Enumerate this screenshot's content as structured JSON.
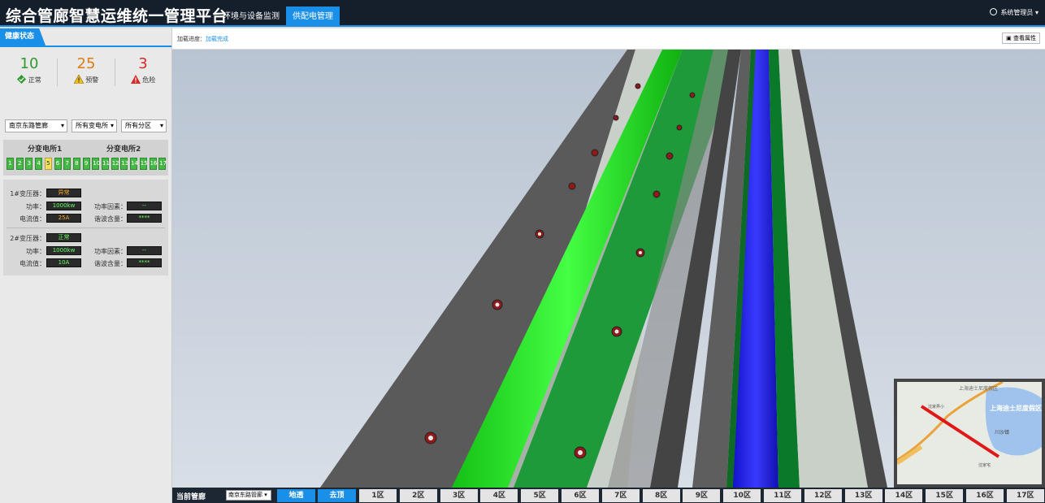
{
  "header": {
    "title": "综合管廊智慧运维统一管理平台",
    "tabs": [
      "环境与设备监测",
      "供配电管理"
    ],
    "active_tab": 1,
    "user": "系统管理员"
  },
  "sidebar": {
    "section_title": "健康状态",
    "counts": [
      {
        "value": "10",
        "label": "正常",
        "color": "#2e9a2e",
        "icon": "diamond-check-icon"
      },
      {
        "value": "25",
        "label": "预警",
        "color": "#e07a10",
        "icon": "warning-icon"
      },
      {
        "value": "3",
        "label": "危险",
        "color": "#d42a2a",
        "icon": "danger-icon"
      }
    ],
    "filters": [
      "南京东路管廊",
      "所有变电所",
      "所有分区"
    ],
    "stations": {
      "labels": [
        "分变电所1",
        "分变电所2"
      ],
      "segments": [
        "1",
        "2",
        "3",
        "4",
        "5",
        "6",
        "7",
        "8",
        "9",
        "10",
        "11",
        "12",
        "13",
        "14",
        "15",
        "16",
        "17"
      ],
      "warning_segment": "5"
    },
    "transformers": [
      {
        "name_label": "1#变压器：",
        "status": "异常",
        "power_label": "功率：",
        "power": "1000kw",
        "factor_label": "功率因素：",
        "factor": "--",
        "current_label": "电流值：",
        "current": "25A",
        "harmonic_label": "谐波含量：",
        "harmonic": "****"
      },
      {
        "name_label": "2#变压器：",
        "status": "正常",
        "power_label": "功率：",
        "power": "1000kw",
        "factor_label": "功率因素：",
        "factor": "--",
        "current_label": "电流值：",
        "current": "10A",
        "harmonic_label": "谐波含量：",
        "harmonic": "****"
      }
    ]
  },
  "main": {
    "load_label": "加载进度：",
    "load_value": "加载完成",
    "attr_button": "查看属性",
    "minimap": {
      "label_top": "上海迪士尼度假区",
      "label_big": "上海迪士尼度假区",
      "label_mid": "沈家弄小",
      "label_right": "川沙镇",
      "label_bottom": "沈家宅"
    }
  },
  "bottombar": {
    "current_label": "当前管廊",
    "current_value": "南京东路管廊",
    "buttons": [
      "地透",
      "去顶"
    ],
    "zones": [
      "1区",
      "2区",
      "3区",
      "4区",
      "5区",
      "6区",
      "7区",
      "8区",
      "9区",
      "10区",
      "11区",
      "12区",
      "13区",
      "14区",
      "15区",
      "16区",
      "17区"
    ]
  },
  "colors": {
    "accent": "#1a8fe8",
    "header_bg": "#151f2c",
    "cable_green": "#22e022",
    "cable_blue": "#2020e0"
  }
}
